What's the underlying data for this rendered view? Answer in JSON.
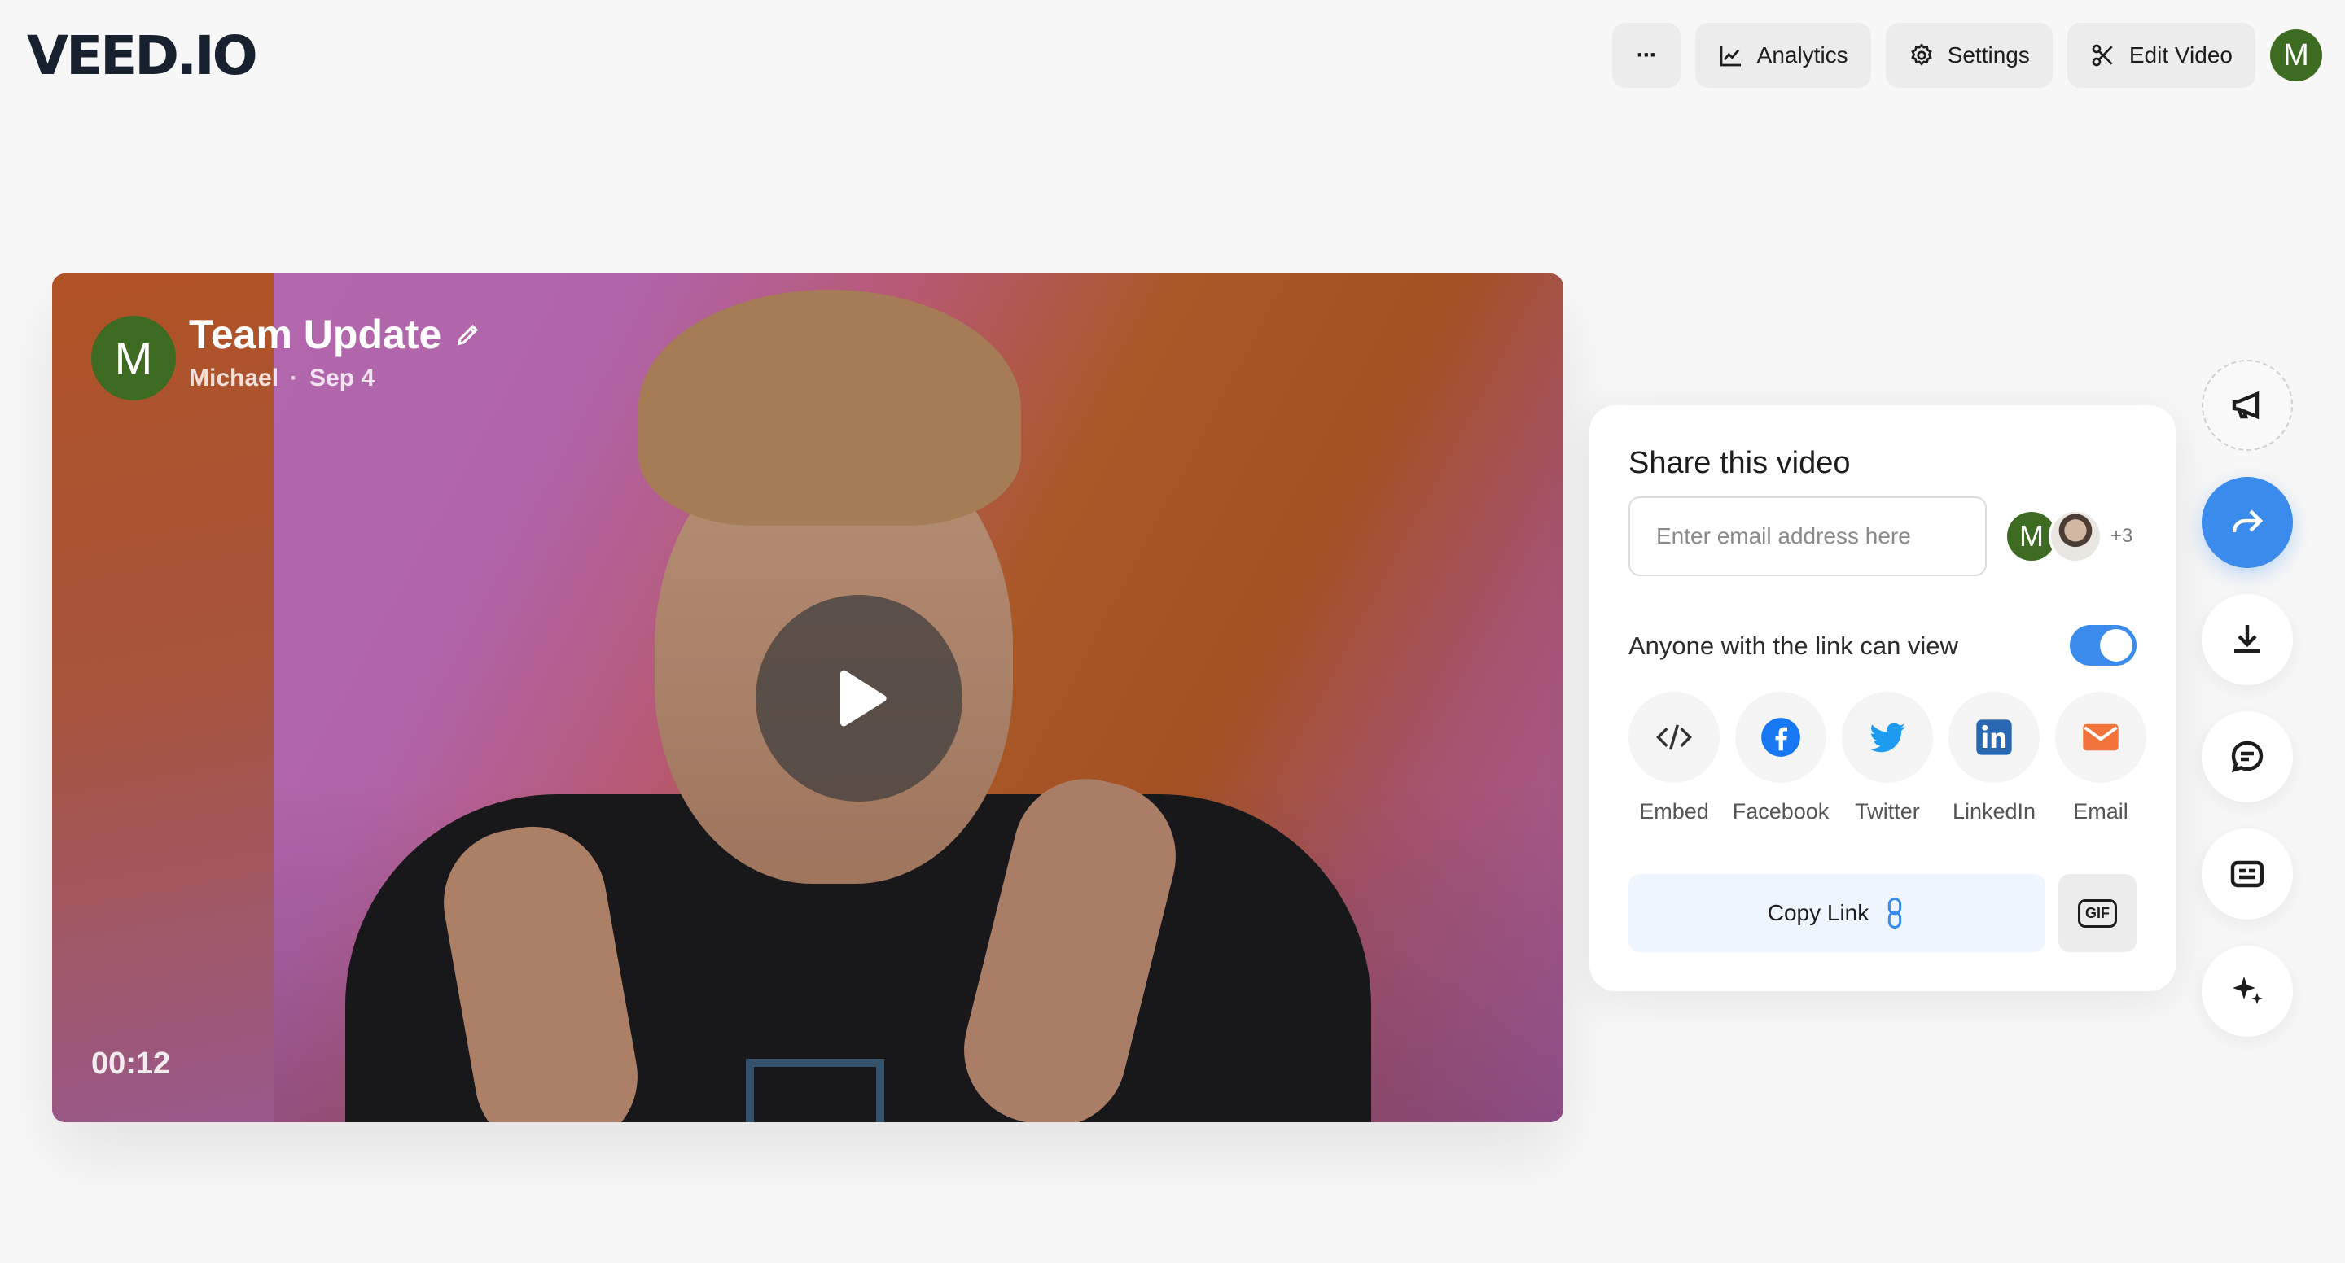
{
  "app": {
    "logo": "VEED.IO"
  },
  "header": {
    "more_label": "···",
    "analytics_label": "Analytics",
    "settings_label": "Settings",
    "edit_label": "Edit Video",
    "user_initial": "M"
  },
  "video": {
    "title": "Team Update",
    "author": "Michael",
    "separator": "·",
    "date": "Sep 4",
    "author_initial": "M",
    "timestamp": "00:12"
  },
  "share": {
    "title": "Share this video",
    "email_placeholder": "Enter email address here",
    "viewer_initial": "M",
    "viewers_more": "+3",
    "link_access_label": "Anyone with the link can view",
    "link_access_enabled": true,
    "options": [
      {
        "label": "Embed",
        "icon": "code-icon"
      },
      {
        "label": "Facebook",
        "icon": "facebook-icon"
      },
      {
        "label": "Twitter",
        "icon": "twitter-icon"
      },
      {
        "label": "LinkedIn",
        "icon": "linkedin-icon"
      },
      {
        "label": "Email",
        "icon": "email-icon"
      }
    ],
    "copy_link_label": "Copy Link",
    "gif_label": "GIF"
  },
  "rail": {
    "icons": [
      "megaphone-icon",
      "share-arrow-icon",
      "download-icon",
      "comment-icon",
      "captions-icon",
      "sparkle-icon"
    ]
  },
  "colors": {
    "accent": "#3a8bec",
    "avatar_green": "#3e6b22",
    "facebook": "#1877f2",
    "twitter": "#1d9bf0",
    "linkedin": "#2867b2",
    "email": "#f2743a"
  }
}
